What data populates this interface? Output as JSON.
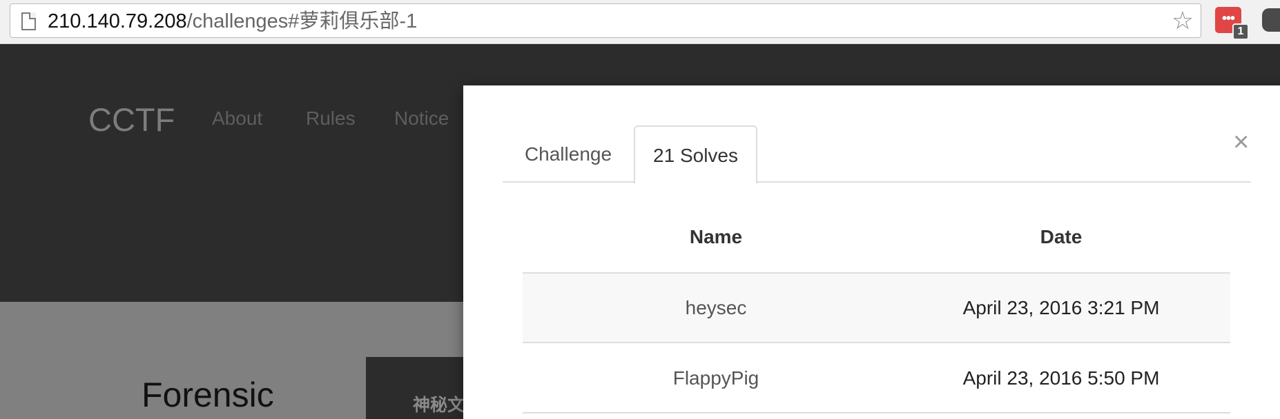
{
  "browser": {
    "url_host": "210.140.79.208",
    "url_path": "/challenges#萝莉俱乐部-1",
    "extension_icon": "•••",
    "extension_badge": "1",
    "icons": [
      "page-icon",
      "star-icon",
      "extension-icon"
    ]
  },
  "site": {
    "brand": "CCTF",
    "nav": [
      "About",
      "Rules",
      "Notice"
    ],
    "category": "Forensic",
    "challenge_tile": "神秘文",
    "colors": {
      "header_bg": "#2c2c2c",
      "backdrop": "#808080"
    }
  },
  "modal": {
    "tabs": [
      "Challenge",
      "21 Solves"
    ],
    "active_tab": "21 Solves",
    "close_icon": "×",
    "table": {
      "columns": [
        "Name",
        "Date"
      ],
      "rows": [
        {
          "name": "heysec",
          "date": "April 23, 2016 3:21 PM"
        },
        {
          "name": "FlappyPig",
          "date": "April 23, 2016 5:50 PM"
        }
      ]
    }
  }
}
